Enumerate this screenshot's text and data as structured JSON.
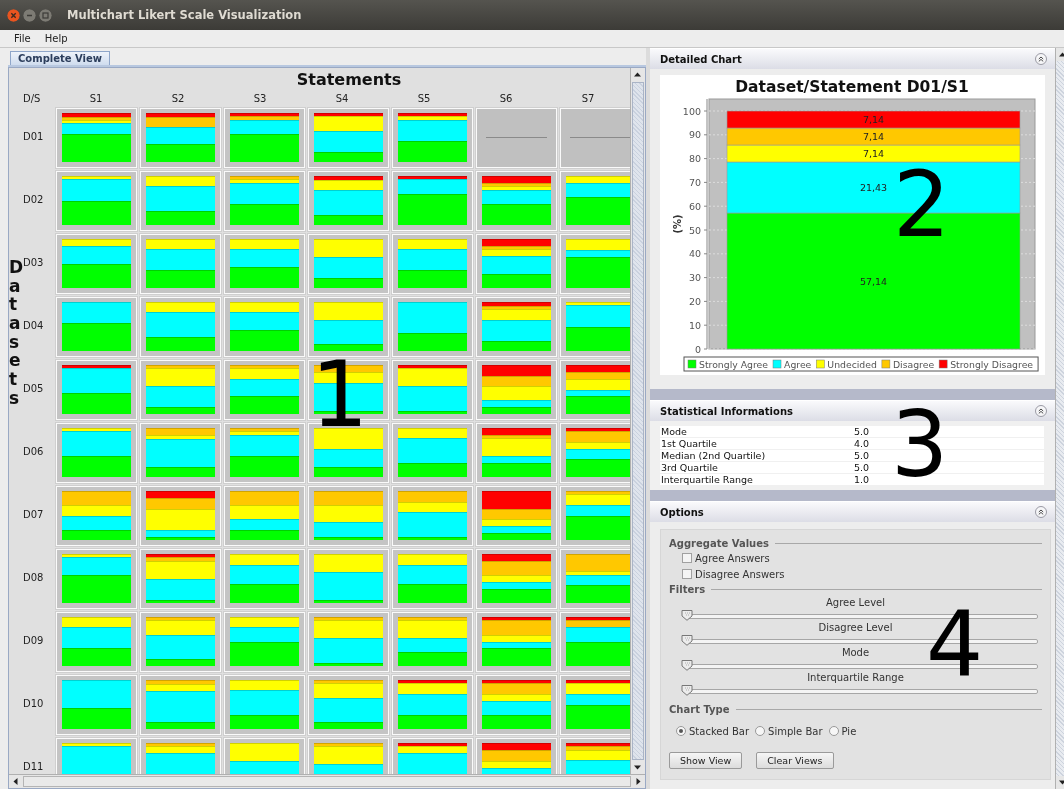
{
  "window": {
    "title": "Multichart Likert Scale Visualization"
  },
  "menu": [
    {
      "label": "File"
    },
    {
      "label": "Help"
    }
  ],
  "tabs": [
    {
      "label": "Complete View",
      "selected": true
    }
  ],
  "grid": {
    "title": "Statements",
    "corner": "D/S",
    "row_axis_title": "Datasets",
    "columns": [
      "S1",
      "S2",
      "S3",
      "S4",
      "S5",
      "S6",
      "S7"
    ],
    "rows": [
      {
        "label": "D01",
        "cells": [
          {
            "kind": "chart"
          },
          {
            "kind": "chart"
          },
          {
            "kind": "chart"
          },
          {
            "kind": "chart"
          },
          {
            "kind": "chart"
          },
          {
            "kind": "empty"
          },
          {
            "kind": "empty"
          }
        ]
      },
      {
        "label": "D02",
        "cells": [
          {
            "kind": "chart"
          },
          {
            "kind": "chart"
          },
          {
            "kind": "chart"
          },
          {
            "kind": "chart"
          },
          {
            "kind": "chart"
          },
          {
            "kind": "chart"
          },
          {
            "kind": "chart"
          }
        ]
      },
      {
        "label": "D03",
        "cells": [
          {
            "kind": "chart"
          },
          {
            "kind": "chart"
          },
          {
            "kind": "chart"
          },
          {
            "kind": "chart"
          },
          {
            "kind": "chart"
          },
          {
            "kind": "chart"
          },
          {
            "kind": "chart"
          }
        ]
      },
      {
        "label": "D04",
        "cells": [
          {
            "kind": "chart"
          },
          {
            "kind": "chart"
          },
          {
            "kind": "chart"
          },
          {
            "kind": "chart"
          },
          {
            "kind": "chart"
          },
          {
            "kind": "chart"
          },
          {
            "kind": "chart"
          }
        ]
      },
      {
        "label": "D05",
        "cells": [
          {
            "kind": "chart"
          },
          {
            "kind": "chart"
          },
          {
            "kind": "chart"
          },
          {
            "kind": "chart"
          },
          {
            "kind": "chart"
          },
          {
            "kind": "chart"
          },
          {
            "kind": "chart"
          }
        ]
      },
      {
        "label": "D06",
        "cells": [
          {
            "kind": "chart"
          },
          {
            "kind": "chart"
          },
          {
            "kind": "chart"
          },
          {
            "kind": "chart"
          },
          {
            "kind": "chart"
          },
          {
            "kind": "chart"
          },
          {
            "kind": "chart"
          }
        ]
      },
      {
        "label": "D07",
        "cells": [
          {
            "kind": "chart"
          },
          {
            "kind": "chart"
          },
          {
            "kind": "chart"
          },
          {
            "kind": "chart"
          },
          {
            "kind": "chart"
          },
          {
            "kind": "chart"
          },
          {
            "kind": "chart"
          }
        ]
      },
      {
        "label": "D08",
        "cells": [
          {
            "kind": "chart"
          },
          {
            "kind": "chart"
          },
          {
            "kind": "chart"
          },
          {
            "kind": "chart"
          },
          {
            "kind": "chart"
          },
          {
            "kind": "chart"
          },
          {
            "kind": "chart"
          }
        ]
      },
      {
        "label": "D09",
        "cells": [
          {
            "kind": "chart"
          },
          {
            "kind": "chart"
          },
          {
            "kind": "chart"
          },
          {
            "kind": "chart"
          },
          {
            "kind": "chart"
          },
          {
            "kind": "chart"
          },
          {
            "kind": "chart"
          }
        ]
      },
      {
        "label": "D10",
        "cells": [
          {
            "kind": "chart"
          },
          {
            "kind": "chart"
          },
          {
            "kind": "chart"
          },
          {
            "kind": "chart"
          },
          {
            "kind": "chart"
          },
          {
            "kind": "chart"
          },
          {
            "kind": "chart"
          }
        ]
      },
      {
        "label": "D11",
        "cells": [
          {
            "kind": "chart"
          },
          {
            "kind": "chart"
          },
          {
            "kind": "chart"
          },
          {
            "kind": "chart"
          },
          {
            "kind": "chart"
          },
          {
            "kind": "chart"
          },
          {
            "kind": "chart"
          }
        ]
      }
    ]
  },
  "detail_panel": {
    "header": "Detailed Chart",
    "chart_data": {
      "type": "bar",
      "title": "Dataset/Statement D01/S1",
      "ylabel": "(%)",
      "grid": true,
      "legend": true,
      "ylim": [
        0,
        100
      ],
      "yticks": [
        0,
        10,
        20,
        30,
        40,
        50,
        60,
        70,
        80,
        90,
        100
      ],
      "stacked": true,
      "series": [
        {
          "name": "Strongly Agree",
          "color": "#00ff00",
          "values": [
            57.14
          ]
        },
        {
          "name": "Agree",
          "color": "#00ffff",
          "values": [
            21.43
          ]
        },
        {
          "name": "Undecided",
          "color": "#ffff00",
          "values": [
            7.14
          ]
        },
        {
          "name": "Disagree",
          "color": "#ffc800",
          "values": [
            7.14
          ]
        },
        {
          "name": "Strongly Disagree",
          "color": "#ff0000",
          "values": [
            7.14
          ]
        }
      ],
      "value_labels": [
        "57,14",
        "21,43",
        "7,14",
        "7,14",
        "7,14"
      ]
    }
  },
  "stats_panel": {
    "header": "Statistical Informations",
    "rows": [
      {
        "name": "Mode",
        "value": "5.0"
      },
      {
        "name": "1st Quartile",
        "value": "4.0"
      },
      {
        "name": "Median (2nd Quartile)",
        "value": "5.0"
      },
      {
        "name": "3rd Quartile",
        "value": "5.0"
      },
      {
        "name": "Interquartile Range",
        "value": "1.0"
      }
    ]
  },
  "options_panel": {
    "header": "Options",
    "aggregate": {
      "title": "Aggregate Values",
      "checkboxes": [
        {
          "label": "Agree Answers",
          "checked": false
        },
        {
          "label": "Disagree Answers",
          "checked": false
        }
      ]
    },
    "filters": {
      "title": "Filters",
      "sliders": [
        {
          "label": "Agree Level",
          "level": 0
        },
        {
          "label": "Disagree Level",
          "level": 0
        },
        {
          "label": "Mode",
          "level": 0
        },
        {
          "label": "Interquartile Range",
          "level": 0
        }
      ]
    },
    "chart_type": {
      "title": "Chart Type",
      "options": [
        {
          "label": "Stacked Bar",
          "selected": true
        },
        {
          "label": "Simple Bar",
          "selected": false
        },
        {
          "label": "Pie",
          "selected": false
        }
      ]
    },
    "buttons": [
      "Show View",
      "Clear Views"
    ]
  },
  "overlay_labels": [
    "1",
    "2",
    "3",
    "4"
  ]
}
